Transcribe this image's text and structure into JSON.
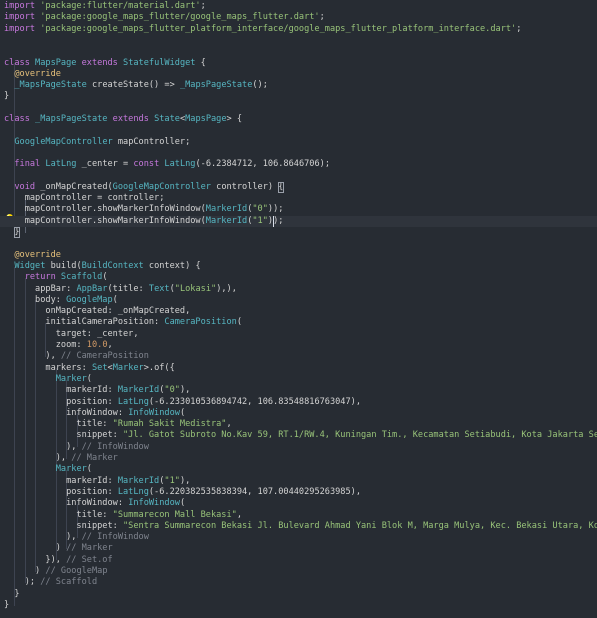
{
  "colors": {
    "background": "#272c33",
    "keyword": "#c678dd",
    "type": "#56b6c2",
    "string": "#98c379",
    "number": "#d19a66",
    "comment": "#7f848e",
    "annotation": "#e5c07b",
    "text": "#d4d4d4",
    "function": "#61afef",
    "const": "#e5c07b"
  },
  "icons": {
    "lightbulb": "lightbulb-icon"
  },
  "lines": [
    [
      [
        "kw",
        "import "
      ],
      [
        "str",
        "'package:flutter/material.dart'"
      ],
      [
        "pl",
        ";"
      ]
    ],
    [
      [
        "kw",
        "import "
      ],
      [
        "str",
        "'package:google_maps_flutter/google_maps_flutter.dart'"
      ],
      [
        "pl",
        ";"
      ]
    ],
    [
      [
        "kw",
        "import "
      ],
      [
        "str",
        "'package:google_maps_flutter_platform_interface/google_maps_flutter_platform_interface.dart'"
      ],
      [
        "pl",
        ";"
      ]
    ],
    [],
    [],
    [
      [
        "kw",
        "class "
      ],
      [
        "ty",
        "MapsPage "
      ],
      [
        "kw",
        "extends "
      ],
      [
        "ty",
        "StatefulWidget"
      ],
      [
        "pl",
        " {"
      ]
    ],
    [
      [
        "pl",
        "  "
      ],
      [
        "an",
        "@override"
      ]
    ],
    [
      [
        "pl",
        "  "
      ],
      [
        "ty",
        "_MapsPageState "
      ],
      [
        "pl",
        "createState() => "
      ],
      [
        "ty",
        "_MapsPageState"
      ],
      [
        "pl",
        "();"
      ]
    ],
    [
      [
        "pl",
        "}"
      ]
    ],
    [],
    [
      [
        "kw",
        "class "
      ],
      [
        "ty",
        "_MapsPageState "
      ],
      [
        "kw",
        "extends "
      ],
      [
        "ty",
        "State"
      ],
      [
        "pl",
        "<"
      ],
      [
        "ty",
        "MapsPage"
      ],
      [
        "pl",
        "> {"
      ]
    ],
    [],
    [
      [
        "pl",
        "  "
      ],
      [
        "ty",
        "GoogleMapController "
      ],
      [
        "pl",
        "mapController;"
      ]
    ],
    [],
    [
      [
        "pl",
        "  "
      ],
      [
        "kw",
        "final "
      ],
      [
        "ty",
        "LatLng "
      ],
      [
        "pl",
        "_center = "
      ],
      [
        "kw",
        "const "
      ],
      [
        "ty",
        "LatLng"
      ],
      [
        "pl",
        "(-6.2384712, 106.8646706);"
      ]
    ],
    [],
    [
      [
        "pl",
        "  "
      ],
      [
        "kw",
        "void "
      ],
      [
        "pl",
        "_onMapCreated("
      ],
      [
        "ty",
        "GoogleMapController "
      ],
      [
        "pl",
        "controller) {"
      ]
    ],
    [
      [
        "pl",
        "    mapController = controller;"
      ]
    ],
    [
      [
        "pl",
        "    mapController.showMarkerInfoWindow("
      ],
      [
        "ty",
        "MarkerId"
      ],
      [
        "pl",
        "("
      ],
      [
        "str",
        "\"0\""
      ],
      [
        "pl",
        "));"
      ]
    ],
    [
      [
        "pl",
        "    mapController.showMarkerInfoWindow("
      ],
      [
        "ty",
        "MarkerId"
      ],
      [
        "pl",
        "("
      ],
      [
        "str",
        "\"1\""
      ],
      [
        "pl",
        "));"
      ]
    ],
    [
      [
        "pl",
        "  }"
      ]
    ],
    [],
    [
      [
        "pl",
        "  "
      ],
      [
        "an",
        "@override"
      ]
    ],
    [
      [
        "pl",
        "  "
      ],
      [
        "ty",
        "Widget "
      ],
      [
        "pl",
        "build("
      ],
      [
        "ty",
        "BuildContext "
      ],
      [
        "pl",
        "context) {"
      ]
    ],
    [
      [
        "pl",
        "    "
      ],
      [
        "kw",
        "return "
      ],
      [
        "ty",
        "Scaffold"
      ],
      [
        "pl",
        "("
      ]
    ],
    [
      [
        "pl",
        "      appBar: "
      ],
      [
        "ty",
        "AppBar"
      ],
      [
        "pl",
        "(title: "
      ],
      [
        "ty",
        "Text"
      ],
      [
        "pl",
        "("
      ],
      [
        "str",
        "\"Lokasi\""
      ],
      [
        "pl",
        "),),"
      ]
    ],
    [
      [
        "pl",
        "      body: "
      ],
      [
        "ty",
        "GoogleMap"
      ],
      [
        "pl",
        "("
      ]
    ],
    [
      [
        "pl",
        "        onMapCreated: _onMapCreated,"
      ]
    ],
    [
      [
        "pl",
        "        initialCameraPosition: "
      ],
      [
        "ty",
        "CameraPosition"
      ],
      [
        "pl",
        "("
      ]
    ],
    [
      [
        "pl",
        "          target: _center,"
      ]
    ],
    [
      [
        "pl",
        "          zoom: "
      ],
      [
        "num",
        "10.0"
      ],
      [
        "pl",
        ","
      ]
    ],
    [
      [
        "pl",
        "        ), "
      ],
      [
        "cm",
        "// CameraPosition"
      ]
    ],
    [
      [
        "pl",
        "        markers: "
      ],
      [
        "ty",
        "Set"
      ],
      [
        "pl",
        "<"
      ],
      [
        "ty",
        "Marker"
      ],
      [
        "pl",
        ">.of({"
      ]
    ],
    [
      [
        "pl",
        "          "
      ],
      [
        "ty",
        "Marker"
      ],
      [
        "pl",
        "("
      ]
    ],
    [
      [
        "pl",
        "            markerId: "
      ],
      [
        "ty",
        "MarkerId"
      ],
      [
        "pl",
        "("
      ],
      [
        "str",
        "\"0\""
      ],
      [
        "pl",
        "),"
      ]
    ],
    [
      [
        "pl",
        "            position: "
      ],
      [
        "ty",
        "LatLng"
      ],
      [
        "pl",
        "(-6.233010536894742, 106.83548816763047),"
      ]
    ],
    [
      [
        "pl",
        "            infoWindow: "
      ],
      [
        "ty",
        "InfoWindow"
      ],
      [
        "pl",
        "("
      ]
    ],
    [
      [
        "pl",
        "              title: "
      ],
      [
        "str",
        "\"Rumah Sakit Medistra\""
      ],
      [
        "pl",
        ","
      ]
    ],
    [
      [
        "pl",
        "              snippet: "
      ],
      [
        "str",
        "\"Jl. Gatot Subroto No.Kav 59, RT.1/RW.4, Kuningan Tim., Kecamatan Setiabudi, Kota Jakarta Selatan"
      ]
    ],
    [
      [
        "pl",
        "            ), "
      ],
      [
        "cm",
        "// InfoWindow"
      ]
    ],
    [
      [
        "pl",
        "          ), "
      ],
      [
        "cm",
        "// Marker"
      ]
    ],
    [
      [
        "pl",
        "          "
      ],
      [
        "ty",
        "Marker"
      ],
      [
        "pl",
        "("
      ]
    ],
    [
      [
        "pl",
        "            markerId: "
      ],
      [
        "ty",
        "MarkerId"
      ],
      [
        "pl",
        "("
      ],
      [
        "str",
        "\"1\""
      ],
      [
        "pl",
        "),"
      ]
    ],
    [
      [
        "pl",
        "            position: "
      ],
      [
        "ty",
        "LatLng"
      ],
      [
        "pl",
        "(-6.220382535838394, 107.00440295263985),"
      ]
    ],
    [
      [
        "pl",
        "            infoWindow: "
      ],
      [
        "ty",
        "InfoWindow"
      ],
      [
        "pl",
        "("
      ]
    ],
    [
      [
        "pl",
        "              title: "
      ],
      [
        "str",
        "\"Summarecon Mall Bekasi\""
      ],
      [
        "pl",
        ","
      ]
    ],
    [
      [
        "pl",
        "              snippet: "
      ],
      [
        "str",
        "\"Sentra Summarecon Bekasi Jl. Bulevard Ahmad Yani Blok M, Marga Mulya, Kec. Bekasi Utara, Kota Bekasi"
      ]
    ],
    [
      [
        "pl",
        "            ), "
      ],
      [
        "cm",
        "// InfoWindow"
      ]
    ],
    [
      [
        "pl",
        "          ) "
      ],
      [
        "cm",
        "// Marker"
      ]
    ],
    [
      [
        "pl",
        "        }), "
      ],
      [
        "cm",
        "// Set.of"
      ]
    ],
    [
      [
        "pl",
        "      ) "
      ],
      [
        "cm",
        "// GoogleMap"
      ]
    ],
    [
      [
        "pl",
        "    ); "
      ],
      [
        "cm",
        "// Scaffold"
      ]
    ],
    [
      [
        "pl",
        "  }"
      ]
    ],
    [
      [
        "pl",
        "}"
      ]
    ]
  ]
}
